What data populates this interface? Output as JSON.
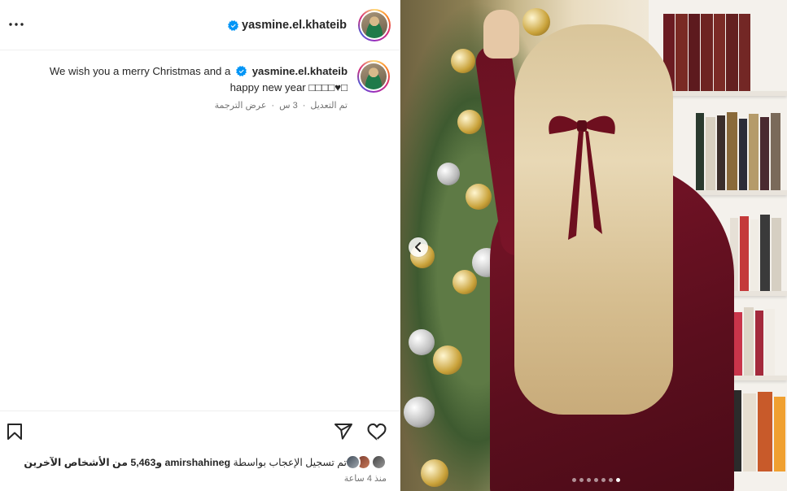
{
  "header": {
    "username": "yasmine.el.khateib",
    "more_icon": "more-horizontal-icon",
    "verified_color": "#0095f6"
  },
  "caption": {
    "username": "yasmine.el.khateib",
    "text_before": "We wish you a merry Christmas and a",
    "text_after": "happy new year □□□□♥□",
    "edited": "تم التعديل",
    "time": "3 س",
    "see_translation": "عرض الترجمة"
  },
  "actions": {
    "like_icon": "heart-icon",
    "share_icon": "share-icon",
    "save_icon": "bookmark-icon"
  },
  "likes": {
    "prefix": "تم تسجيل الإعجاب بواسطة",
    "liker": "amirshahineg",
    "suffix": "و5,463 من الأشخاص الآخرين"
  },
  "time_ago": "منذ 4 ساعة",
  "carousel": {
    "slide_count": 7,
    "active_index": 6
  }
}
